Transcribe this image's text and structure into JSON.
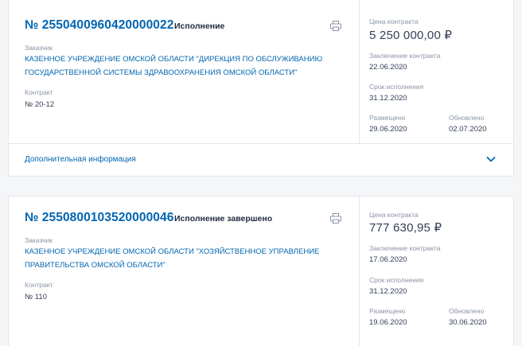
{
  "cards": [
    {
      "number": "№ 2550400960420000022",
      "status": "Исполнение",
      "customer_label": "Заказчик",
      "customer": "КАЗЕННОЕ УЧРЕЖДЕНИЕ ОМСКОЙ ОБЛАСТИ \"ДИРЕКЦИЯ ПО ОБСЛУЖИВАНИЮ ГОСУДАРСТВЕННОЙ СИСТЕМЫ ЗДРАВООХРАНЕНИЯ ОМСКОЙ ОБЛАСТИ\"",
      "contract_label": "Контракт",
      "contract": "№ 20-12",
      "price_label": "Цена контракта",
      "price": "5 250 000,00 ₽",
      "conclusion_label": "Заключение контракта",
      "conclusion": "22.06.2020",
      "term_label": "Срок исполнения",
      "term": "31.12.2020",
      "placed_label": "Размещено",
      "placed": "29.06.2020",
      "updated_label": "Обновлено",
      "updated": "02.07.2020",
      "more_label": "Дополнительная информация"
    },
    {
      "number": "№ 2550800103520000046",
      "status": "Исполнение завершено",
      "customer_label": "Заказчик",
      "customer": "КАЗЕННОЕ УЧРЕЖДЕНИЕ ОМСКОЙ ОБЛАСТИ \"ХОЗЯЙСТВЕННОЕ УПРАВЛЕНИЕ ПРАВИТЕЛЬСТВА ОМСКОЙ ОБЛАСТИ\"",
      "contract_label": "Контракт",
      "contract": "№ 110",
      "price_label": "Цена контракта",
      "price": "777 630,95 ₽",
      "conclusion_label": "Заключение контракта",
      "conclusion": "17.06.2020",
      "term_label": "Срок исполнения",
      "term": "31.12.2020",
      "placed_label": "Размещено",
      "placed": "19.06.2020",
      "updated_label": "Обновлено",
      "updated": "30.06.2020"
    }
  ],
  "colors": {
    "link": "#0065b1",
    "muted": "#8a94a6",
    "text": "#334059",
    "border": "#e4e7ec"
  },
  "icons": [
    "printer-icon",
    "chevron-down-icon"
  ]
}
